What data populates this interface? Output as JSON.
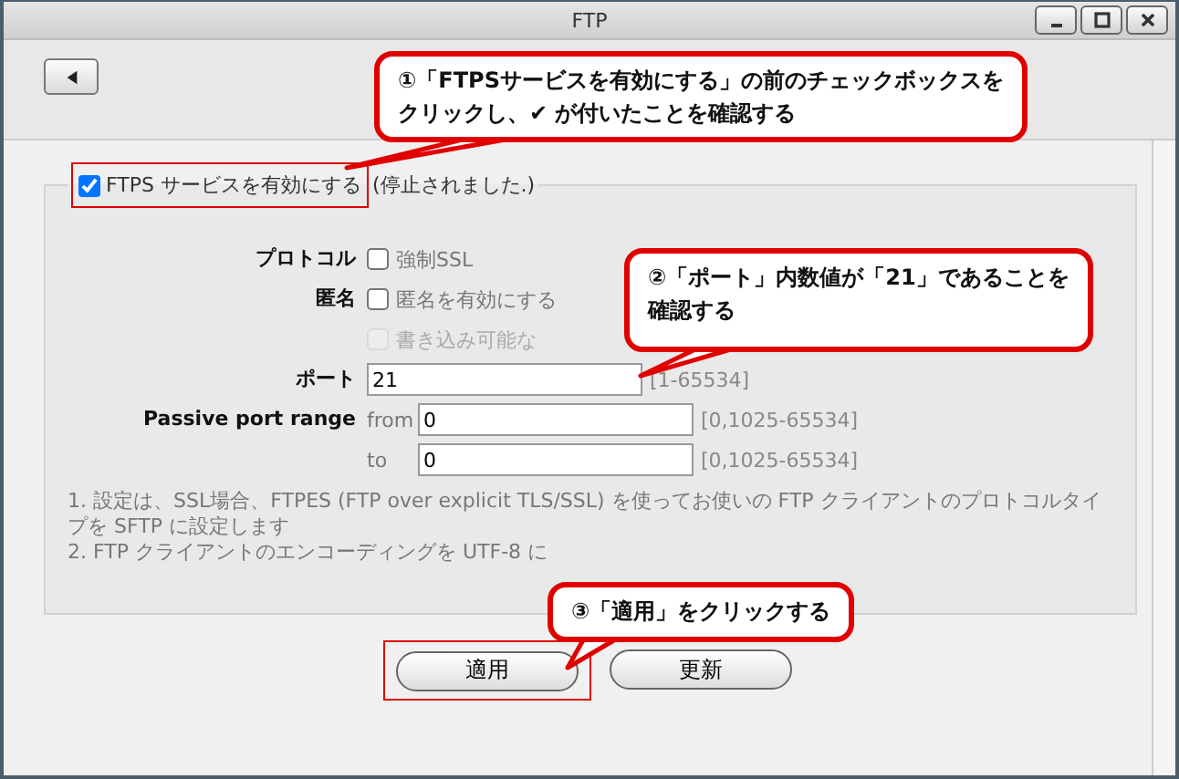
{
  "window": {
    "title": "FTP"
  },
  "ftps": {
    "label": "FTPS サービスを有効にする",
    "checked": true,
    "status": "(停止されました.)"
  },
  "rows": [
    {
      "kind": "checkbox",
      "label": "プロトコル",
      "option": "強制SSL",
      "checked": false,
      "disabled": false
    },
    {
      "kind": "checkbox",
      "label": "匿名",
      "option": "匿名を有効にする",
      "checked": false,
      "disabled": false
    },
    {
      "kind": "checkbox",
      "option": "書き込み可能な",
      "checked": false,
      "disabled": true
    },
    {
      "kind": "text",
      "label": "ポート",
      "value": "21",
      "range": "[1-65534]"
    },
    {
      "kind": "text",
      "label": "Passive port range",
      "prefix": "from",
      "value": "0",
      "range": "[0,1025-65534]"
    },
    {
      "kind": "text",
      "prefix": "to",
      "value": "0",
      "range": "[0,1025-65534]"
    }
  ],
  "notes": [
    "1. 設定は、SSL場合、FTPES (FTP over explicit TLS/SSL) を使ってお使いの FTP クライアントのプロトコルタイプを SFTP に設定します",
    "2. FTP クライアントのエンコーディングを UTF-8 に"
  ],
  "buttons": [
    {
      "label": "適用"
    },
    {
      "label": "更新"
    }
  ],
  "callouts": [
    {
      "lines": [
        "①「FTPSサービスを有効にする」の前のチェックボックスを",
        "クリックし、✔ が付いたことを確認する"
      ]
    },
    {
      "lines": [
        "②「ポート」内数値が「21」であることを",
        "確認する"
      ]
    },
    {
      "lines": [
        "③「適用」をクリックする"
      ]
    }
  ]
}
